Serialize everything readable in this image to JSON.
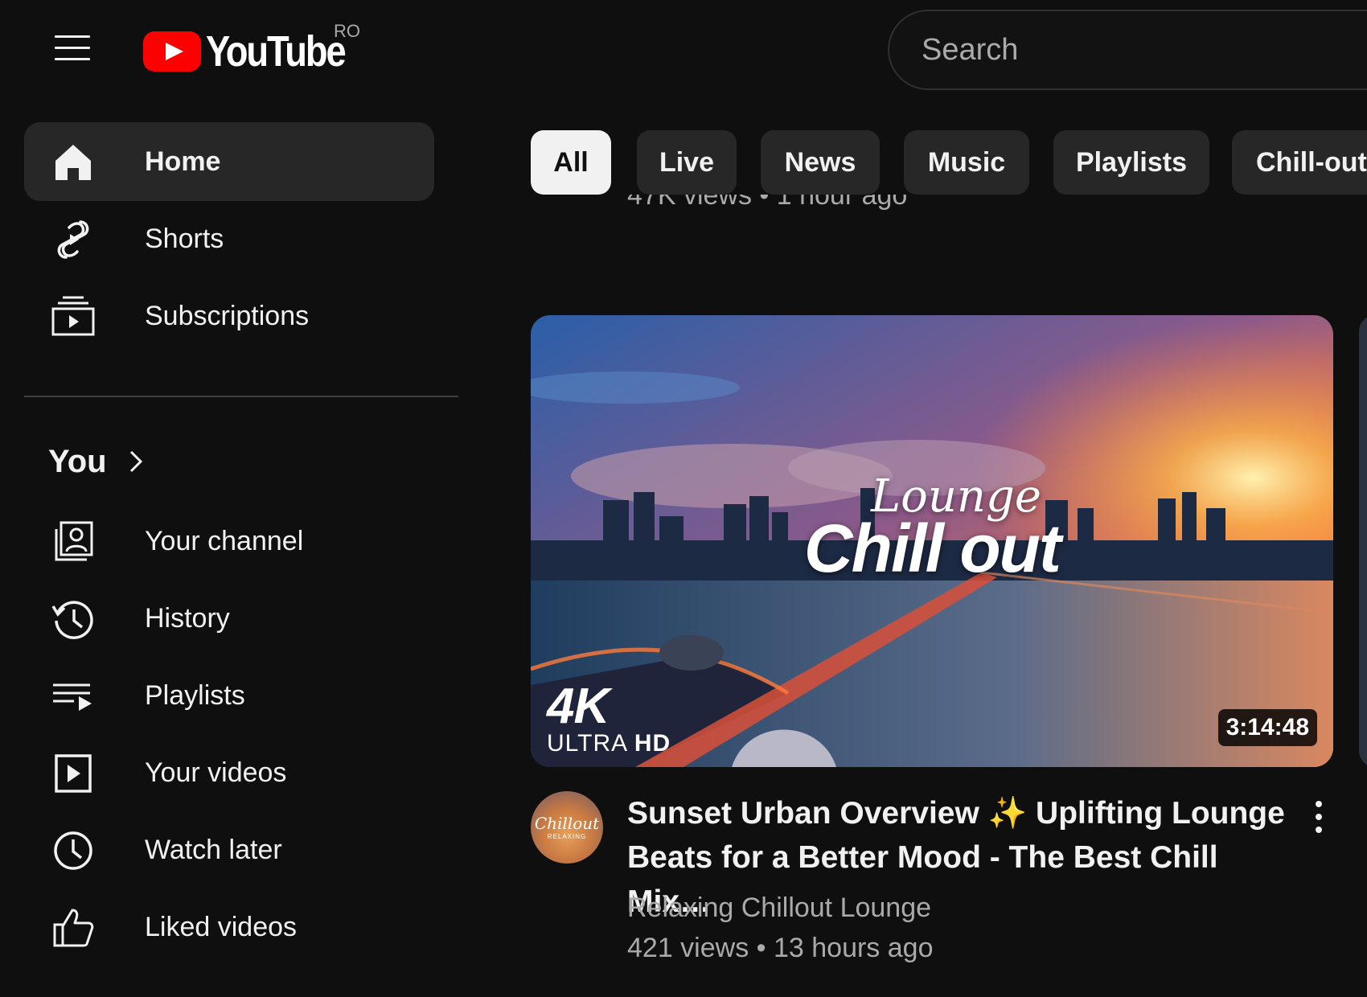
{
  "header": {
    "menu_icon": "hamburger-menu-icon",
    "logo_text": "YouTube",
    "region_code": "RO",
    "search_placeholder": "Search"
  },
  "sidebar": {
    "items": [
      {
        "label": "Home",
        "icon": "home-icon",
        "active": true
      },
      {
        "label": "Shorts",
        "icon": "shorts-icon"
      },
      {
        "label": "Subscriptions",
        "icon": "subscriptions-icon"
      }
    ],
    "you_section": {
      "title": "You",
      "icon": "chevron-right-icon",
      "items": [
        {
          "label": "Your channel",
          "icon": "your-channel-icon"
        },
        {
          "label": "History",
          "icon": "history-icon"
        },
        {
          "label": "Playlists",
          "icon": "playlists-icon"
        },
        {
          "label": "Your videos",
          "icon": "your-videos-icon"
        },
        {
          "label": "Watch later",
          "icon": "watch-later-icon"
        },
        {
          "label": "Liked videos",
          "icon": "liked-videos-icon"
        }
      ]
    }
  },
  "chips": [
    {
      "label": "All",
      "active": true
    },
    {
      "label": "Live"
    },
    {
      "label": "News"
    },
    {
      "label": "Music"
    },
    {
      "label": "Playlists"
    },
    {
      "label": "Chill-out"
    }
  ],
  "previous_video": {
    "meta": "47K views • 1 hour ago"
  },
  "video": {
    "thumbnail_text_1": "Lounge",
    "thumbnail_text_2": "Chill out",
    "badge_4k": "4K",
    "badge_ultra": "ULTRA",
    "badge_hd": "HD",
    "duration": "3:14:48",
    "title": "Sunset Urban Overview ✨ Uplifting Lounge Beats for a Better Mood - The Best Chill Mix…",
    "channel": "Relaxing Chillout Lounge",
    "stats": "421 views • 13 hours ago",
    "avatar_text_1": "Chillout",
    "avatar_text_2": "RELAXING",
    "menu_icon": "more-vert-icon"
  },
  "colors": {
    "background": "#0f0f0f",
    "surface": "#272727",
    "text": "#f1f1f1",
    "secondary_text": "#aaaaaa",
    "brand_red": "#ff0000"
  }
}
